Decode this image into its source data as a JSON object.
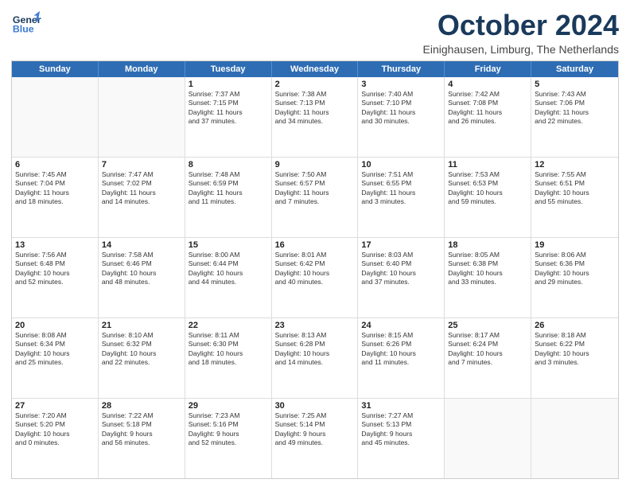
{
  "header": {
    "logo": {
      "line1": "General",
      "line2": "Blue"
    },
    "title": "October 2024",
    "subtitle": "Einighausen, Limburg, The Netherlands"
  },
  "calendar": {
    "days_of_week": [
      "Sunday",
      "Monday",
      "Tuesday",
      "Wednesday",
      "Thursday",
      "Friday",
      "Saturday"
    ],
    "rows": [
      [
        {
          "day": "",
          "lines": []
        },
        {
          "day": "",
          "lines": []
        },
        {
          "day": "1",
          "lines": [
            "Sunrise: 7:37 AM",
            "Sunset: 7:15 PM",
            "Daylight: 11 hours",
            "and 37 minutes."
          ]
        },
        {
          "day": "2",
          "lines": [
            "Sunrise: 7:38 AM",
            "Sunset: 7:13 PM",
            "Daylight: 11 hours",
            "and 34 minutes."
          ]
        },
        {
          "day": "3",
          "lines": [
            "Sunrise: 7:40 AM",
            "Sunset: 7:10 PM",
            "Daylight: 11 hours",
            "and 30 minutes."
          ]
        },
        {
          "day": "4",
          "lines": [
            "Sunrise: 7:42 AM",
            "Sunset: 7:08 PM",
            "Daylight: 11 hours",
            "and 26 minutes."
          ]
        },
        {
          "day": "5",
          "lines": [
            "Sunrise: 7:43 AM",
            "Sunset: 7:06 PM",
            "Daylight: 11 hours",
            "and 22 minutes."
          ]
        }
      ],
      [
        {
          "day": "6",
          "lines": [
            "Sunrise: 7:45 AM",
            "Sunset: 7:04 PM",
            "Daylight: 11 hours",
            "and 18 minutes."
          ]
        },
        {
          "day": "7",
          "lines": [
            "Sunrise: 7:47 AM",
            "Sunset: 7:02 PM",
            "Daylight: 11 hours",
            "and 14 minutes."
          ]
        },
        {
          "day": "8",
          "lines": [
            "Sunrise: 7:48 AM",
            "Sunset: 6:59 PM",
            "Daylight: 11 hours",
            "and 11 minutes."
          ]
        },
        {
          "day": "9",
          "lines": [
            "Sunrise: 7:50 AM",
            "Sunset: 6:57 PM",
            "Daylight: 11 hours",
            "and 7 minutes."
          ]
        },
        {
          "day": "10",
          "lines": [
            "Sunrise: 7:51 AM",
            "Sunset: 6:55 PM",
            "Daylight: 11 hours",
            "and 3 minutes."
          ]
        },
        {
          "day": "11",
          "lines": [
            "Sunrise: 7:53 AM",
            "Sunset: 6:53 PM",
            "Daylight: 10 hours",
            "and 59 minutes."
          ]
        },
        {
          "day": "12",
          "lines": [
            "Sunrise: 7:55 AM",
            "Sunset: 6:51 PM",
            "Daylight: 10 hours",
            "and 55 minutes."
          ]
        }
      ],
      [
        {
          "day": "13",
          "lines": [
            "Sunrise: 7:56 AM",
            "Sunset: 6:48 PM",
            "Daylight: 10 hours",
            "and 52 minutes."
          ]
        },
        {
          "day": "14",
          "lines": [
            "Sunrise: 7:58 AM",
            "Sunset: 6:46 PM",
            "Daylight: 10 hours",
            "and 48 minutes."
          ]
        },
        {
          "day": "15",
          "lines": [
            "Sunrise: 8:00 AM",
            "Sunset: 6:44 PM",
            "Daylight: 10 hours",
            "and 44 minutes."
          ]
        },
        {
          "day": "16",
          "lines": [
            "Sunrise: 8:01 AM",
            "Sunset: 6:42 PM",
            "Daylight: 10 hours",
            "and 40 minutes."
          ]
        },
        {
          "day": "17",
          "lines": [
            "Sunrise: 8:03 AM",
            "Sunset: 6:40 PM",
            "Daylight: 10 hours",
            "and 37 minutes."
          ]
        },
        {
          "day": "18",
          "lines": [
            "Sunrise: 8:05 AM",
            "Sunset: 6:38 PM",
            "Daylight: 10 hours",
            "and 33 minutes."
          ]
        },
        {
          "day": "19",
          "lines": [
            "Sunrise: 8:06 AM",
            "Sunset: 6:36 PM",
            "Daylight: 10 hours",
            "and 29 minutes."
          ]
        }
      ],
      [
        {
          "day": "20",
          "lines": [
            "Sunrise: 8:08 AM",
            "Sunset: 6:34 PM",
            "Daylight: 10 hours",
            "and 25 minutes."
          ]
        },
        {
          "day": "21",
          "lines": [
            "Sunrise: 8:10 AM",
            "Sunset: 6:32 PM",
            "Daylight: 10 hours",
            "and 22 minutes."
          ]
        },
        {
          "day": "22",
          "lines": [
            "Sunrise: 8:11 AM",
            "Sunset: 6:30 PM",
            "Daylight: 10 hours",
            "and 18 minutes."
          ]
        },
        {
          "day": "23",
          "lines": [
            "Sunrise: 8:13 AM",
            "Sunset: 6:28 PM",
            "Daylight: 10 hours",
            "and 14 minutes."
          ]
        },
        {
          "day": "24",
          "lines": [
            "Sunrise: 8:15 AM",
            "Sunset: 6:26 PM",
            "Daylight: 10 hours",
            "and 11 minutes."
          ]
        },
        {
          "day": "25",
          "lines": [
            "Sunrise: 8:17 AM",
            "Sunset: 6:24 PM",
            "Daylight: 10 hours",
            "and 7 minutes."
          ]
        },
        {
          "day": "26",
          "lines": [
            "Sunrise: 8:18 AM",
            "Sunset: 6:22 PM",
            "Daylight: 10 hours",
            "and 3 minutes."
          ]
        }
      ],
      [
        {
          "day": "27",
          "lines": [
            "Sunrise: 7:20 AM",
            "Sunset: 5:20 PM",
            "Daylight: 10 hours",
            "and 0 minutes."
          ]
        },
        {
          "day": "28",
          "lines": [
            "Sunrise: 7:22 AM",
            "Sunset: 5:18 PM",
            "Daylight: 9 hours",
            "and 56 minutes."
          ]
        },
        {
          "day": "29",
          "lines": [
            "Sunrise: 7:23 AM",
            "Sunset: 5:16 PM",
            "Daylight: 9 hours",
            "and 52 minutes."
          ]
        },
        {
          "day": "30",
          "lines": [
            "Sunrise: 7:25 AM",
            "Sunset: 5:14 PM",
            "Daylight: 9 hours",
            "and 49 minutes."
          ]
        },
        {
          "day": "31",
          "lines": [
            "Sunrise: 7:27 AM",
            "Sunset: 5:13 PM",
            "Daylight: 9 hours",
            "and 45 minutes."
          ]
        },
        {
          "day": "",
          "lines": []
        },
        {
          "day": "",
          "lines": []
        }
      ]
    ]
  }
}
